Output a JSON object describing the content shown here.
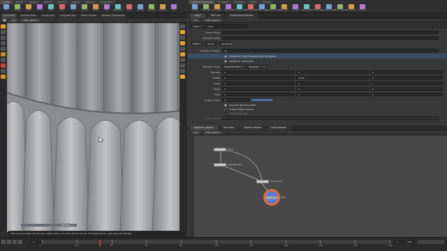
{
  "shelf": {
    "tabs": [
      "Create",
      "Modify",
      "Polygon",
      "Deform",
      "Texture",
      "Rigging",
      "Muscles",
      "Characters",
      "Constraints",
      "Hair Utils",
      "Guide Process",
      "Guide Brushes",
      "Terrain FX",
      "Simple FX",
      "Cloud FX",
      "Volume"
    ],
    "tools": [
      "Box",
      "Sphere",
      "Tube",
      "Torus",
      "Grid",
      "Null",
      "Line",
      "Circle",
      "Curve",
      "Path",
      "Spray Paint",
      "Font",
      "Platonic",
      "L-System",
      "Metaball",
      "File"
    ],
    "right_tabs": [
      "Lights and Cameras",
      "Collisions",
      "Particles",
      "Grains",
      "Vellum",
      "Rigid Bodies",
      "Particle Fluids",
      "Viscous Fluids",
      "Oceans"
    ],
    "right_tools": [
      "Camera",
      "Point Light",
      "Spot Light",
      "Area Light",
      "Geometry Light",
      "Volume Light",
      "Distant Light",
      "Environment Light",
      "Sky Light",
      "GI Light",
      "Caustic Light",
      "Portal Light",
      "Ambient Light",
      "Stereo Camera",
      "VR Camera",
      "Switcher"
    ]
  },
  "left": {
    "tabs": [
      "Scene View",
      "Animation Editor",
      "Render View",
      "Composite View",
      "Motion FX View",
      "Geometry Spreadsheet"
    ],
    "view_label": "View",
    "path": [
      "obj",
      "tube_object1"
    ],
    "status": "Left mouse tumbles. Middle pans. Right dollies. Ctrl+Alt+Left box-zooms. Ctrl+Right zooms. Spacebar-Ctrl-Left tilts."
  },
  "params": {
    "tabs": [
      "copy1",
      "Take List",
      "Performance Monitor"
    ],
    "path": [
      "obj",
      "tube_object1"
    ],
    "node_type": "Copy",
    "node_name": "copy1",
    "source_group_label": "Source Group",
    "template_group_label": "Template Group",
    "subtabs": [
      "Copy",
      "Stamp",
      "Attributes"
    ],
    "num_copies_label": "Number of Copies",
    "num_copies": "24",
    "transform_using": "Transform Using Template Point Attributes",
    "transform_cumulative": "Transform Cumulative",
    "xform_order_label": "Transform Order",
    "xform_order": "Scale Rot Trans",
    "rot_order": "Rx Ry Rz",
    "rows": [
      {
        "label": "Translate",
        "v": [
          "0",
          "0",
          "0"
        ]
      },
      {
        "label": "Rotate",
        "v": [
          "0",
          "14.85",
          "0"
        ]
      },
      {
        "label": "Scale",
        "v": [
          "1",
          "1",
          "1"
        ]
      },
      {
        "label": "Shear",
        "v": [
          "0",
          "0",
          "0"
        ]
      },
      {
        "label": "Pivot",
        "v": [
          "0",
          "0",
          "0"
        ]
      }
    ],
    "uniform_scale_label": "Uniform Scale",
    "uniform_scale": "1",
    "preserve_normal": "Preserve Normal Length",
    "create_groups": "Create Output Groups",
    "preserve_groups": "Preserve Groups",
    "copy_groups_label": "Copy Groups"
  },
  "network": {
    "tabs": [
      "/obj/tube_object1",
      "Tree View",
      "Material Palette",
      "Asset Browser"
    ],
    "path": [
      "obj",
      "tube_object1"
    ],
    "nodes": [
      {
        "name": "tube1"
      },
      {
        "name": "polyextrude1"
      },
      {
        "name": "transform1"
      },
      {
        "name": "copy1"
      }
    ]
  },
  "timeline": {
    "ticks": [
      "1",
      "24",
      "48",
      "72",
      "96",
      "120",
      "144",
      "168",
      "192",
      "216",
      "240"
    ],
    "current_frame": "1",
    "start": "1",
    "end": "240"
  },
  "colors": {
    "selected_node": "#5a7ad0",
    "display_flag": "#3b6fd8",
    "copy_ring": "#e36b3b"
  }
}
